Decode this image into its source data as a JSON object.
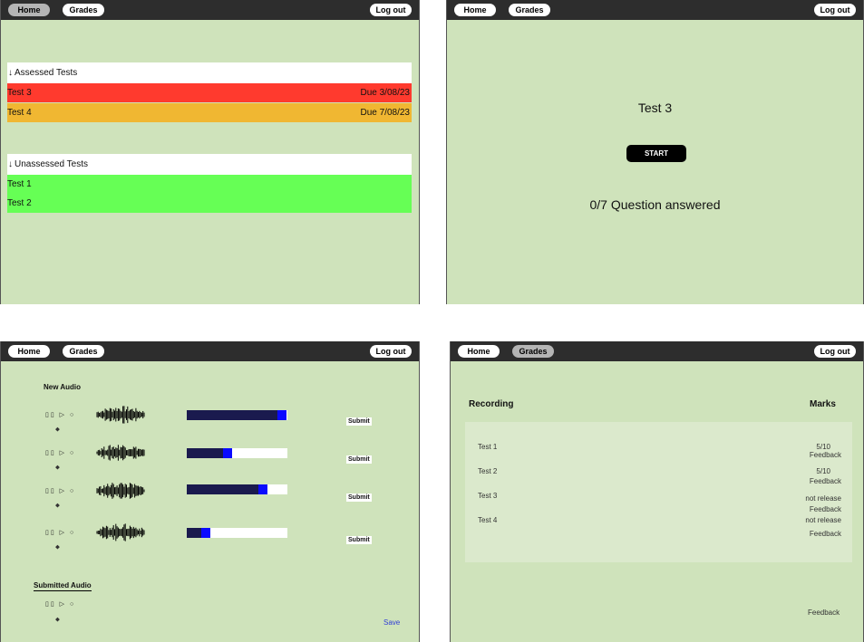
{
  "nav": {
    "home": "Home",
    "grades": "Grades",
    "logout": "Log out"
  },
  "screen1": {
    "assessed_header": "Assessed Tests",
    "assessed": [
      {
        "name": "Test 3",
        "due": "Due 3/08/23",
        "color": "#ff3a2e"
      },
      {
        "name": "Test 4",
        "due": "Due 7/08/23",
        "color": "#f0b732"
      }
    ],
    "unassessed_header": "Unassessed Tests",
    "unassessed": [
      {
        "name": "Test 1",
        "color": "#66ff55"
      },
      {
        "name": "Test 2",
        "color": "#66ff55"
      }
    ]
  },
  "screen2": {
    "title": "Test 3",
    "start": "START",
    "progress_text": "0/7 Question answered"
  },
  "screen3": {
    "new_audio": "New Audio",
    "controls": "▯▯ ▷ ○",
    "dot": "⬥",
    "submit": "Submit",
    "tracks": [
      {
        "progress": 0.99
      },
      {
        "progress": 0.45
      },
      {
        "progress": 0.8
      },
      {
        "progress": 0.23
      }
    ],
    "submitted_audio": "Submitted Audio",
    "save": "Save"
  },
  "screen4": {
    "recording_header": "Recording",
    "marks_header": "Marks",
    "rows": [
      {
        "name": "Test 1",
        "mark": "5/10",
        "feedback": "Feedback"
      },
      {
        "name": "Test 2",
        "mark": "5/10",
        "feedback": "Feedback"
      },
      {
        "name": "Test 3",
        "mark": "not release",
        "feedback": "Feedback"
      },
      {
        "name": "Test 4",
        "mark": "not release",
        "feedback": "Feedback"
      }
    ],
    "footer_feedback": "Feedback"
  }
}
